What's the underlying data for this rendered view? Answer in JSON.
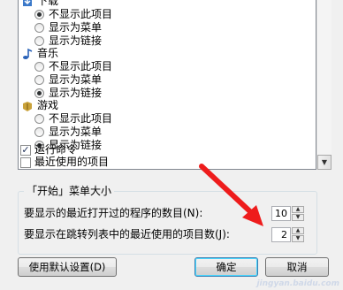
{
  "list": {
    "items": [
      {
        "type": "category",
        "label": "下载",
        "icon": "download-icon"
      },
      {
        "type": "radio",
        "label": "不显示此项目",
        "selected": true
      },
      {
        "type": "radio",
        "label": "显示为菜单",
        "selected": false
      },
      {
        "type": "radio",
        "label": "显示为链接",
        "selected": false
      },
      {
        "type": "category",
        "label": "音乐",
        "icon": "music-icon"
      },
      {
        "type": "radio",
        "label": "不显示此项目",
        "selected": false
      },
      {
        "type": "radio",
        "label": "显示为菜单",
        "selected": false
      },
      {
        "type": "radio",
        "label": "显示为链接",
        "selected": true
      },
      {
        "type": "category",
        "label": "游戏",
        "icon": "games-icon"
      },
      {
        "type": "radio",
        "label": "不显示此项目",
        "selected": false
      },
      {
        "type": "radio",
        "label": "显示为菜单",
        "selected": false
      },
      {
        "type": "radio",
        "label": "显示为链接",
        "selected": true
      },
      {
        "type": "checkbox",
        "label": "运行命令",
        "checked": true
      },
      {
        "type": "checkbox",
        "label": "最近使用的项目",
        "checked": false
      }
    ]
  },
  "size_group": {
    "title": "「开始」菜单大小",
    "recent_programs_label": "要显示的最近打开过的程序的数目(N):",
    "recent_programs_value": "10",
    "jump_list_label": "要显示在跳转列表中的最近使用的项目数(J):",
    "jump_list_value": "2"
  },
  "buttons": {
    "use_defaults": "使用默认设置(D)",
    "ok": "确定",
    "cancel": "取消"
  },
  "watermark": "jingyan.baidu.com",
  "colors": {
    "annotation_arrow": "#ee1c1c"
  }
}
